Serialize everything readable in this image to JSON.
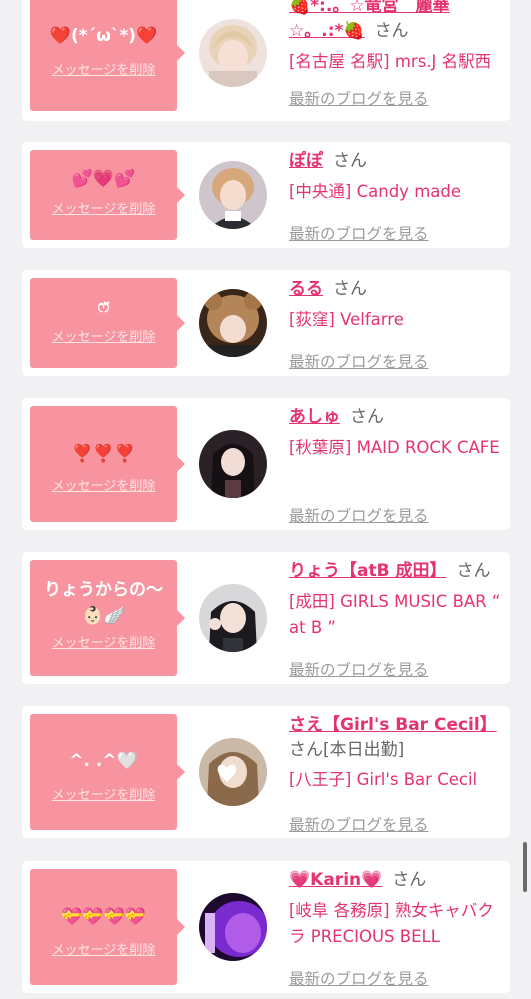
{
  "delete_label": "メッセージを削除",
  "blog_label": "最新のブログを見る",
  "san_label": "さん",
  "colors": {
    "bubble": "#f7949f",
    "name": "#e6336f",
    "background": "#f1f1f3"
  },
  "items": [
    {
      "message": "❤️(*´ω`*)❤️",
      "name": "🍓*:.。☆竜宮　麗華☆。.:*🍓",
      "shop": "[名古屋 名駅] mrs.J 名駅西"
    },
    {
      "message": "💕💗💕",
      "name": "ぽぽ",
      "shop": "[中央通] Candy made"
    },
    {
      "message": "ෆ̈",
      "name": "るる",
      "shop": "[荻窪] Velfarre"
    },
    {
      "message": "❣️❣️❣️",
      "name": "あしゅ",
      "shop": "[秋葉原] MAID ROCK CAFE"
    },
    {
      "message": "りょうからの〜👶🏻🪽",
      "name": "りょう【atB 成田】",
      "shop": "[成田] GIRLS MUSIC BAR “ at B ”"
    },
    {
      "message": "^. .^🤍",
      "name": "さえ【Girl's Bar Cecil】",
      "shop": "[八王子] Girl's Bar Cecil",
      "status": "[本日出勤]"
    },
    {
      "message": "💝💝💝💝",
      "name": "💗Karin💗",
      "shop": "[岐阜 各務原] 熟女キャバクラ PRECIOUS BELL"
    }
  ]
}
